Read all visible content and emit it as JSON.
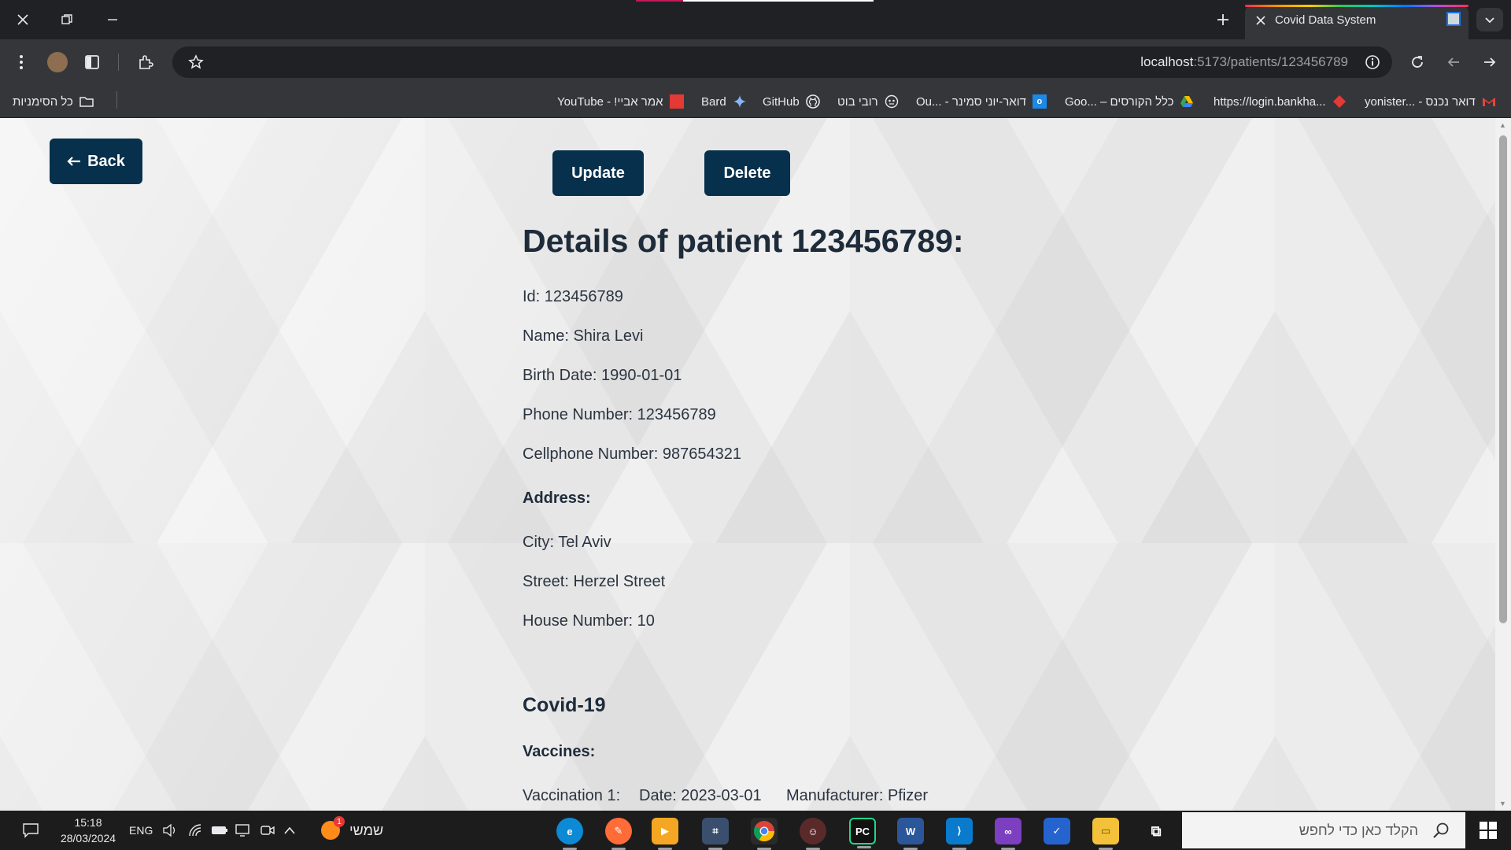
{
  "browser": {
    "tab_title": "Covid Data System",
    "url_host": "localhost",
    "url_path": ":5173/patients/123456789",
    "bookmarks_all_label": "כל הסימניות",
    "bookmarks": [
      {
        "label": "YouTube - !אמר אביי",
        "icon": "red-square-icon",
        "color": "#e53935"
      },
      {
        "label": "Bard",
        "icon": "sparkle-icon",
        "color": "#8ab4f8"
      },
      {
        "label": "GitHub",
        "icon": "github-icon",
        "color": "#e8eaed"
      },
      {
        "label": "רובי בוט",
        "icon": "robot-icon",
        "color": "#e8eaed"
      },
      {
        "label": "Ou... - דואר-יוני סמינר",
        "icon": "outlook-icon",
        "color": "#1e88e5"
      },
      {
        "label": "Goo... – כלל הקורסים",
        "icon": "drive-icon",
        "color": "#fbbc04"
      },
      {
        "label": "https://login.bankha...",
        "icon": "red-diamond-icon",
        "color": "#e53935"
      },
      {
        "label": "yonister... - דואר נכנס",
        "icon": "gmail-icon",
        "color": "#ea4335"
      }
    ]
  },
  "page": {
    "back_label": "Back",
    "update_label": "Update",
    "delete_label": "Delete",
    "title": "Details of patient 123456789:",
    "fields": {
      "id": "Id: 123456789",
      "name": "Name: Shira Levi",
      "birth_date": "Birth Date: 1990-01-01",
      "phone": "Phone Number: 123456789",
      "cellphone": "Cellphone Number: 987654321"
    },
    "address_heading": "Address:",
    "address": {
      "city": "City: Tel Aviv",
      "street": "Street: Herzel Street",
      "house_number": "House Number: 10"
    },
    "covid_heading": "Covid-19",
    "vaccines_heading": "Vaccines:",
    "vaccinations": [
      {
        "label": "Vaccination 1:",
        "date": "Date: 2023-03-01",
        "manufacturer": "Manufacturer: Pfizer"
      }
    ]
  },
  "taskbar": {
    "time": "15:18",
    "date": "28/03/2024",
    "lang": "ENG",
    "weather_label": "שמשי",
    "weather_badge": "1",
    "search_placeholder": "הקלד כאן כדי לחפש",
    "apps": [
      {
        "name": "edge-app",
        "color": "#0c8ad6",
        "glyph": "e"
      },
      {
        "name": "postman-app",
        "color": "#ff6c37",
        "glyph": "✎"
      },
      {
        "name": "media-player-app",
        "color": "#f5a623",
        "glyph": "▶"
      },
      {
        "name": "sql-server-app",
        "color": "#3a4f6e",
        "glyph": "⌗"
      },
      {
        "name": "chrome-app",
        "color": "#34a853",
        "glyph": "◉"
      },
      {
        "name": "assistant-app",
        "color": "#5a2a2a",
        "glyph": "☺"
      },
      {
        "name": "pycharm-app",
        "color": "#111111",
        "glyph": "PC"
      },
      {
        "name": "word-app",
        "color": "#2b579a",
        "glyph": "W"
      },
      {
        "name": "vscode-app",
        "color": "#0a7acc",
        "glyph": "⟩"
      },
      {
        "name": "visual-studio-app",
        "color": "#7b3fbf",
        "glyph": "∞"
      },
      {
        "name": "todo-app",
        "color": "#2564cf",
        "glyph": "✓"
      },
      {
        "name": "file-explorer-app",
        "color": "#f3c13a",
        "glyph": "▭"
      },
      {
        "name": "task-view-app",
        "color": "#1c1c1c",
        "glyph": "⧉"
      }
    ]
  }
}
